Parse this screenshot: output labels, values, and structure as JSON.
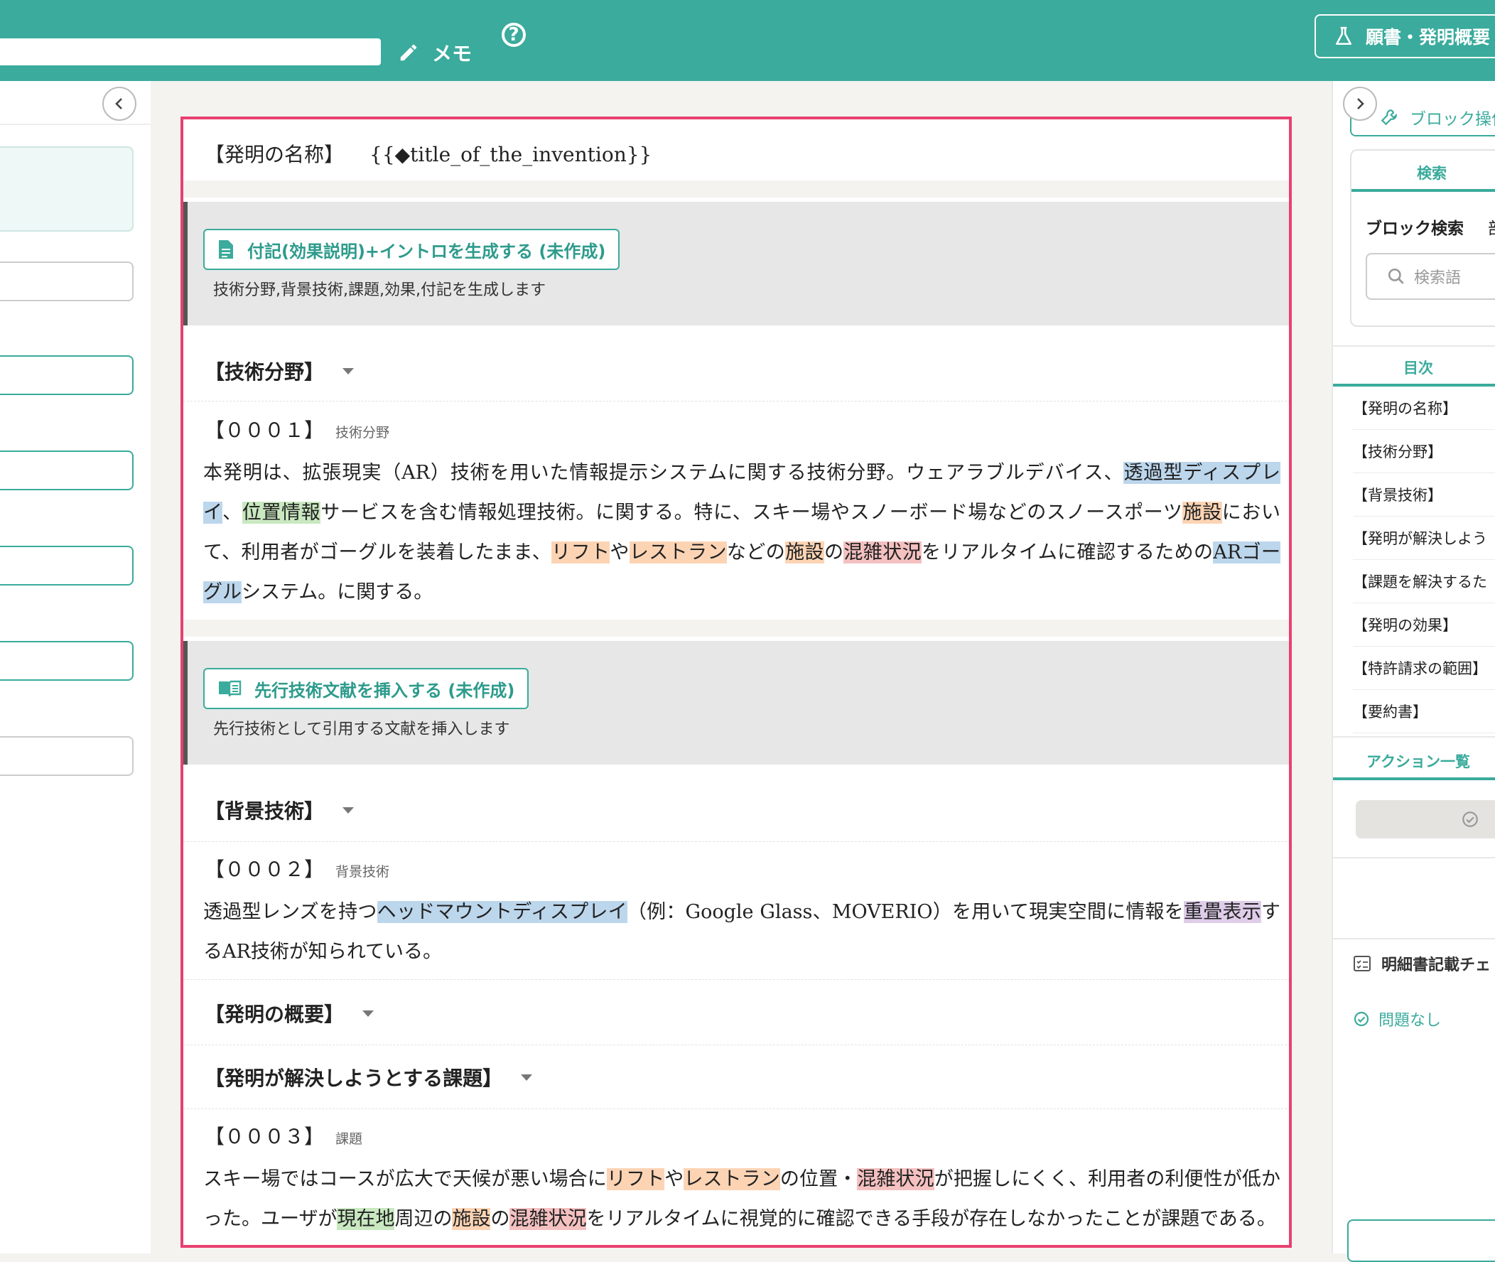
{
  "header": {
    "memo_label": "メモ",
    "help_glyph": "?",
    "top_right_button": "願書・発明概要"
  },
  "document": {
    "title_label": "【発明の名称】",
    "title_value": "{{◆title_of_the_invention}}",
    "generate_intro": {
      "button": "付記(効果説明)+イントロを生成する (未作成)",
      "description": "技術分野,背景技術,課題,効果,付記を生成します"
    },
    "section_tech_field": "【技術分野】",
    "para1": {
      "number": "【０００１】",
      "tag": "技術分野",
      "segments": [
        {
          "t": "本発明は、拡張現実（AR）技術を用いた情報提示システムに関する技術分野。ウェアラブルデバイス、"
        },
        {
          "t": "透過型ディスプレイ",
          "h": "blue"
        },
        {
          "t": "、"
        },
        {
          "t": "位置情報",
          "h": "green"
        },
        {
          "t": "サービスを含む情報処理技術。に関する。特に、スキー場やスノーボード場などのスノースポーツ"
        },
        {
          "t": "施設",
          "h": "orange"
        },
        {
          "t": "において、利用者がゴーグルを装着したまま、"
        },
        {
          "t": "リフト",
          "h": "orange"
        },
        {
          "t": "や"
        },
        {
          "t": "レストラン",
          "h": "orange"
        },
        {
          "t": "などの"
        },
        {
          "t": "施設",
          "h": "orange"
        },
        {
          "t": "の"
        },
        {
          "t": "混雑状況",
          "h": "red"
        },
        {
          "t": "をリアルタイムに確認するための"
        },
        {
          "t": "ARゴーグル",
          "h": "blue"
        },
        {
          "t": "システム。に関する。"
        }
      ]
    },
    "insert_prior_art": {
      "button": "先行技術文献を挿入する (未作成)",
      "description": "先行技術として引用する文献を挿入します"
    },
    "section_background": "【背景技術】",
    "para2": {
      "number": "【０００２】",
      "tag": "背景技術",
      "segments": [
        {
          "t": "透過型レンズを持つ"
        },
        {
          "t": "ヘッドマウントディスプレイ",
          "h": "blue"
        },
        {
          "t": "（例：Google Glass、MOVERIO）を用いて現実空間に情報を"
        },
        {
          "t": "重畳表示",
          "h": "purple"
        },
        {
          "t": "するAR技術が知られている。"
        }
      ]
    },
    "section_summary": "【発明の概要】",
    "section_problem": "【発明が解決しようとする課題】",
    "para3": {
      "number": "【０００３】",
      "tag": "課題",
      "segments": [
        {
          "t": "スキー場ではコースが広大で天候が悪い場合に"
        },
        {
          "t": "リフト",
          "h": "orange"
        },
        {
          "t": "や"
        },
        {
          "t": "レストラン",
          "h": "orange"
        },
        {
          "t": "の位置・"
        },
        {
          "t": "混雑状況",
          "h": "red"
        },
        {
          "t": "が把握しにくく、利用者の利便性が低かった。ユーザが"
        },
        {
          "t": "現在地",
          "h": "green"
        },
        {
          "t": "周辺の"
        },
        {
          "t": "施設",
          "h": "orange"
        },
        {
          "t": "の"
        },
        {
          "t": "混雑状況",
          "h": "red"
        },
        {
          "t": "をリアルタイムに視覚的に確認できる手段が存在しなかったことが課題である。"
        }
      ]
    }
  },
  "right_panel": {
    "block_ops_button": "ブロック操作",
    "search_tab": "検索",
    "block_search_title": "ブロック検索",
    "block_search_extra": "部",
    "search_placeholder": "検索語",
    "toc_tab": "目次",
    "toc_items": [
      "【発明の名称】",
      "【技術分野】",
      "【背景技術】",
      "【発明が解決しよう",
      "【課題を解決するた",
      "【発明の効果】",
      "【特許請求の範囲】",
      "【要約書】"
    ],
    "actions_tab": "アクション一覧",
    "check_title": "明細書記載チェ",
    "check_status": "問題なし"
  },
  "colors": {
    "brand": "#3aab9c",
    "frame": "#e8406f"
  }
}
